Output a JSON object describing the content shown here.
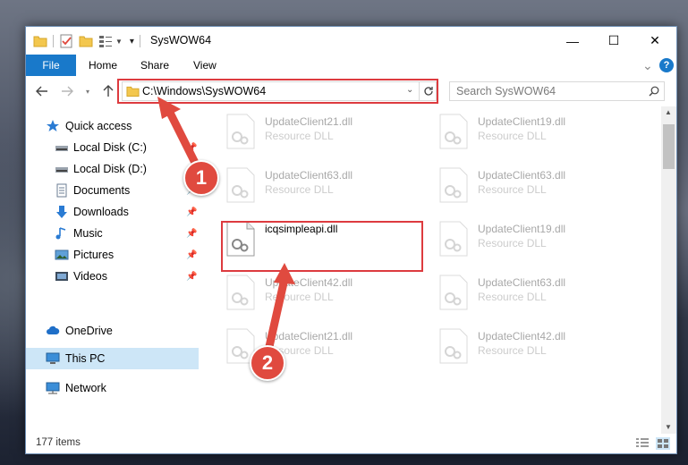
{
  "window": {
    "title": "SysWOW64",
    "controls": {
      "minimize": "—",
      "maximize": "☐",
      "close": "✕"
    }
  },
  "ribbon": {
    "tabs": [
      "File",
      "Home",
      "Share",
      "View"
    ],
    "expand_icon": "⌄",
    "help_icon": "?"
  },
  "nav": {
    "address": "C:\\Windows\\SysWOW64",
    "search_placeholder": "Search SysWOW64"
  },
  "sidebar": {
    "items": [
      {
        "label": "Quick access",
        "icon": "star-icon",
        "pinned": false
      },
      {
        "label": "Local Disk (C:)",
        "icon": "drive-icon",
        "pinned": true
      },
      {
        "label": "Local Disk (D:)",
        "icon": "drive-icon",
        "pinned": true
      },
      {
        "label": "Documents",
        "icon": "documents-icon",
        "pinned": true
      },
      {
        "label": "Downloads",
        "icon": "download-icon",
        "pinned": true
      },
      {
        "label": "Music",
        "icon": "music-icon",
        "pinned": true
      },
      {
        "label": "Pictures",
        "icon": "pictures-icon",
        "pinned": true
      },
      {
        "label": "Videos",
        "icon": "videos-icon",
        "pinned": true
      },
      {
        "label": "OneDrive",
        "icon": "cloud-icon",
        "pinned": false
      },
      {
        "label": "This PC",
        "icon": "computer-icon",
        "pinned": false,
        "selected": true
      },
      {
        "label": "Network",
        "icon": "network-icon",
        "pinned": false
      }
    ]
  },
  "files": [
    {
      "name": "UpdateClient21.dll",
      "type": "Resource DLL",
      "faded": true
    },
    {
      "name": "UpdateClient19.dll",
      "type": "Resource DLL",
      "faded": true
    },
    {
      "name": "UpdateClient63.dll",
      "type": "Resource DLL",
      "faded": true
    },
    {
      "name": "UpdateClient63.dll",
      "type": "Resource DLL",
      "faded": true
    },
    {
      "name": "icqsimpleapi.dll",
      "type": "",
      "faded": false
    },
    {
      "name": "UpdateClient19.dll",
      "type": "Resource DLL",
      "faded": true
    },
    {
      "name": "UpdateClient42.dll",
      "type": "Resource DLL",
      "faded": true
    },
    {
      "name": "UpdateClient63.dll",
      "type": "Resource DLL",
      "faded": true
    },
    {
      "name": "UpdateClient21.dll",
      "type": "Resource DLL",
      "faded": true
    },
    {
      "name": "UpdateClient42.dll",
      "type": "Resource DLL",
      "faded": true
    }
  ],
  "status": {
    "item_count": "177 items"
  },
  "annotations": {
    "step1": "1",
    "step2": "2",
    "color": "#e04a3f"
  }
}
